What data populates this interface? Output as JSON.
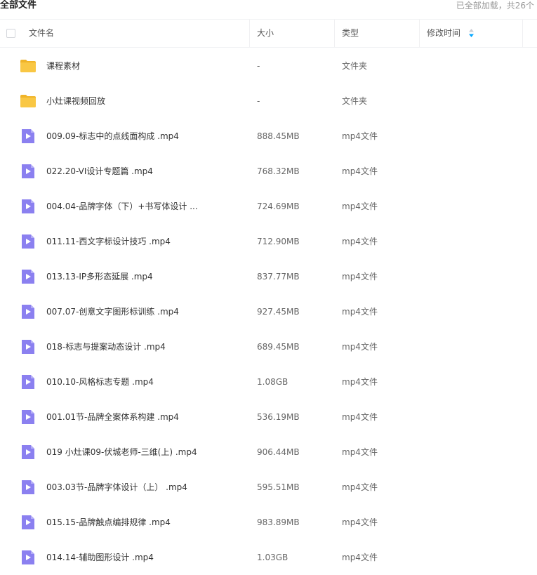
{
  "header": {
    "title": "全部文件",
    "loaded_status": "已全部加载，共26个"
  },
  "columns": {
    "name": "文件名",
    "size": "大小",
    "type": "类型",
    "modified": "修改时间"
  },
  "icons": {
    "folder": "folder-icon",
    "video": "video-file-icon",
    "sort": "sort-icon",
    "folder_color": "#f9c744",
    "video_color": "#8b80f0"
  },
  "files": [
    {
      "name": "课程素材",
      "size": "-",
      "type": "文件夹",
      "kind": "folder"
    },
    {
      "name": "小灶课视频回放",
      "size": "-",
      "type": "文件夹",
      "kind": "folder"
    },
    {
      "name": "009.09-标志中的点线面构成 .mp4",
      "size": "888.45MB",
      "type": "mp4文件",
      "kind": "video"
    },
    {
      "name": "022.20-VI设计专题篇 .mp4",
      "size": "768.32MB",
      "type": "mp4文件",
      "kind": "video"
    },
    {
      "name": "004.04-品牌字体（下）+书写体设计 ...",
      "size": "724.69MB",
      "type": "mp4文件",
      "kind": "video"
    },
    {
      "name": "011.11-西文字标设计技巧 .mp4",
      "size": "712.90MB",
      "type": "mp4文件",
      "kind": "video"
    },
    {
      "name": "013.13-IP多形态延展 .mp4",
      "size": "837.77MB",
      "type": "mp4文件",
      "kind": "video"
    },
    {
      "name": "007.07-创意文字图形标训练 .mp4",
      "size": "927.45MB",
      "type": "mp4文件",
      "kind": "video"
    },
    {
      "name": "018-标志与提案动态设计 .mp4",
      "size": "689.45MB",
      "type": "mp4文件",
      "kind": "video"
    },
    {
      "name": "010.10-风格标志专题 .mp4",
      "size": "1.08GB",
      "type": "mp4文件",
      "kind": "video"
    },
    {
      "name": "001.01节-品牌全案体系构建 .mp4",
      "size": "536.19MB",
      "type": "mp4文件",
      "kind": "video"
    },
    {
      "name": "019 小灶课09-伏城老师-三维(上) .mp4",
      "size": "906.44MB",
      "type": "mp4文件",
      "kind": "video"
    },
    {
      "name": "003.03节-品牌字体设计（上） .mp4",
      "size": "595.51MB",
      "type": "mp4文件",
      "kind": "video"
    },
    {
      "name": "015.15-品牌触点编排规律 .mp4",
      "size": "983.89MB",
      "type": "mp4文件",
      "kind": "video"
    },
    {
      "name": "014.14-辅助图形设计 .mp4",
      "size": "1.03GB",
      "type": "mp4文件",
      "kind": "video"
    }
  ]
}
